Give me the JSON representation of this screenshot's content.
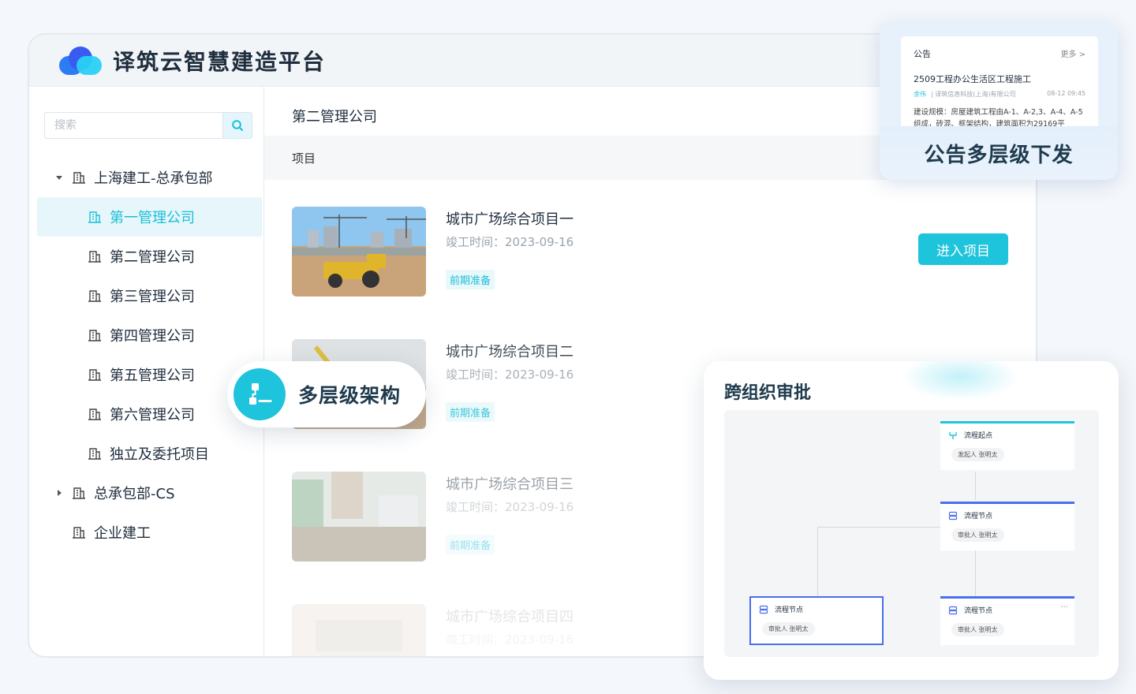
{
  "app": {
    "title": "译筑云智慧建造平台"
  },
  "search": {
    "placeholder": "搜索"
  },
  "tree": [
    {
      "label": "上海建工-总承包部",
      "level": 0,
      "expanded": true
    },
    {
      "label": "第一管理公司",
      "level": 1,
      "active": true
    },
    {
      "label": "第二管理公司",
      "level": 1
    },
    {
      "label": "第三管理公司",
      "level": 1
    },
    {
      "label": "第四管理公司",
      "level": 1
    },
    {
      "label": "第五管理公司",
      "level": 1
    },
    {
      "label": "第六管理公司",
      "level": 1
    },
    {
      "label": "独立及委托项目",
      "level": 1
    },
    {
      "label": "总承包部-CS",
      "level": 0,
      "expanded": false
    },
    {
      "label": "企业建工",
      "level": 0,
      "leaf": true
    }
  ],
  "content": {
    "title": "第二管理公司",
    "section": "项目",
    "enter_label": "进入项目",
    "projects": [
      {
        "name": "城市广场综合项目一",
        "date": "竣工时间：2023-09-16",
        "tag": "前期准备"
      },
      {
        "name": "城市广场综合项目二",
        "date": "竣工时间：2023-09-16",
        "tag": "前期准备"
      },
      {
        "name": "城市广场综合项目三",
        "date": "竣工时间：2023-09-16",
        "tag": "前期准备"
      },
      {
        "name": "城市广场综合项目四",
        "date": "竣工时间：2023-09-16",
        "tag": ""
      }
    ]
  },
  "pill": {
    "label": "多层级架构"
  },
  "notice": {
    "header": "公告",
    "more": "更多 >",
    "title": "2509工程办公生活区工程施工",
    "author": "余伟",
    "org": "|  译筑信息科技(上海)有限公司",
    "time": "08-12 09:45",
    "body": "建设规模：房屋建筑工程由A-1、A-2,3、A-4、A-5组成，砖混、框架结构，建筑面积为29169平",
    "feature": "公告多层级下发"
  },
  "approval": {
    "title": "跨组织审批",
    "nodes": [
      {
        "name": "流程起点",
        "chip": "发起人  张明太"
      },
      {
        "name": "流程节点",
        "chip": "审批人  张明太"
      },
      {
        "name": "流程节点",
        "chip": "审批人  张明太"
      },
      {
        "name": "流程节点",
        "chip": "审批人  张明太"
      }
    ],
    "more": "···"
  },
  "colors": {
    "accent": "#1ec3dc",
    "flow": "#4a6ef0",
    "text": "#1f2d3d"
  }
}
